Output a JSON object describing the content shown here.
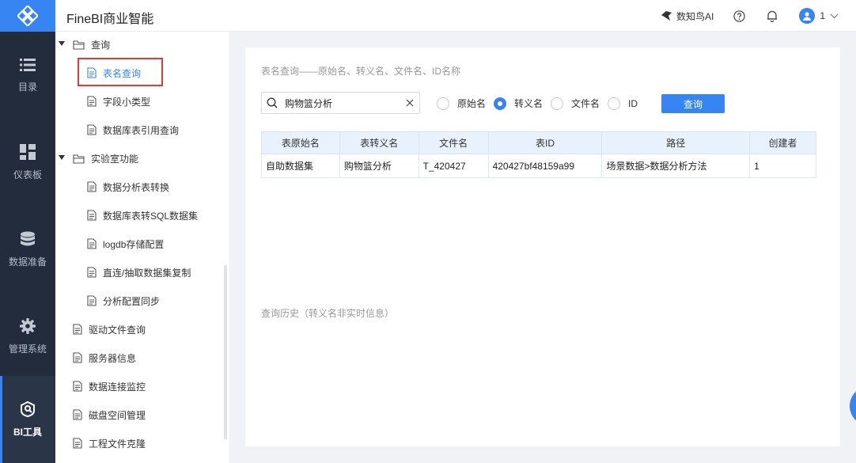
{
  "app": {
    "title": "FineBI商业智能"
  },
  "header": {
    "ai_label": "数知鸟AI",
    "user_name": "1"
  },
  "leftnav": [
    {
      "label": "目录",
      "icon": "list-icon"
    },
    {
      "label": "仪表板",
      "icon": "dashboard-icon"
    },
    {
      "label": "数据准备",
      "icon": "database-icon"
    },
    {
      "label": "管理系统",
      "icon": "gear-icon"
    },
    {
      "label": "BI工具",
      "icon": "bi-tool-icon",
      "active": true
    }
  ],
  "tree": {
    "group_query": "查询",
    "query_items": [
      "表名查询",
      "字段小类型",
      "数据库表引用查询"
    ],
    "group_lab": "实验室功能",
    "lab_items": [
      "数据分析表转换",
      "数据库表转SQL数据集",
      "logdb存储配置",
      "直连/抽取数据集复制",
      "分析配置同步"
    ],
    "root_items": [
      "驱动文件查询",
      "服务器信息",
      "数据连接监控",
      "磁盘空间管理",
      "工程文件克隆"
    ],
    "selected": "表名查询"
  },
  "main": {
    "subtitle": "表名查询——原始名、转义名、文件名、ID名称",
    "search_value": "购物篮分析",
    "radio_options": [
      {
        "label": "原始名",
        "checked": false
      },
      {
        "label": "转义名",
        "checked": true
      },
      {
        "label": "文件名",
        "checked": false
      },
      {
        "label": "ID",
        "checked": false
      }
    ],
    "query_button": "查询",
    "table": {
      "columns": [
        "表原始名",
        "表转义名",
        "文件名",
        "表ID",
        "路径",
        "创建者"
      ],
      "rows": [
        [
          "自助数据集",
          "购物篮分析",
          "T_420427",
          "420427bf48159a99",
          "场景数据>数据分析方法",
          "1"
        ]
      ]
    },
    "history_label": "查询历史（转义名非实时信息）"
  },
  "colors": {
    "accent": "#3685f2",
    "nav_bg": "#232c3d",
    "highlight_border": "#e53935"
  }
}
